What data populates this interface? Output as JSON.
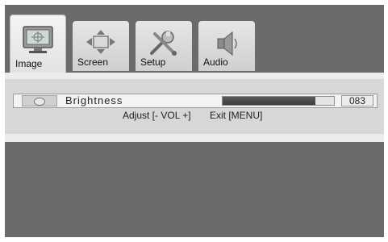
{
  "tabs": [
    {
      "label": "Image",
      "icon": "monitor-icon",
      "active": true
    },
    {
      "label": "Screen",
      "icon": "arrows-icon",
      "active": false
    },
    {
      "label": "Setup",
      "icon": "tools-icon",
      "active": false
    },
    {
      "label": "Audio",
      "icon": "speaker-icon",
      "active": false
    }
  ],
  "setting": {
    "name": "Brightness",
    "level": 0.83,
    "value": "083",
    "icon": "sun-icon"
  },
  "hint": {
    "adjust": "Adjust [- VOL +]",
    "exit": "Exit [MENU]"
  },
  "colors": {
    "background": "#6b6b6b",
    "panel": "#d7d7d7",
    "bar_fill": "#4a4a4a"
  }
}
